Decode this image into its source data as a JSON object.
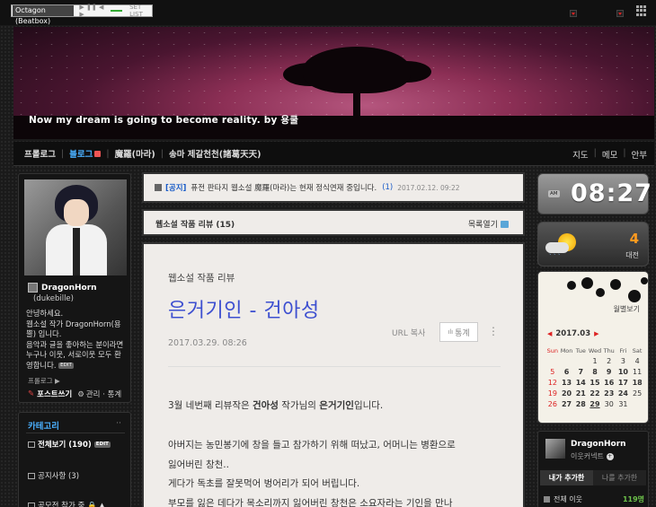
{
  "topbar": {
    "beatbox_title": "Octagon (Beatbox)",
    "player_controls": "▶ ❚❚ ◀ ▶",
    "list_label": "SET LIST"
  },
  "banner": {
    "slogan": "Now my dream is going to become reality. by 용쿨"
  },
  "nav": {
    "items": [
      {
        "label": "프롤로그"
      },
      {
        "label": "블로그"
      },
      {
        "label": "魔羅(마라)"
      },
      {
        "label": "송마 제갈천천(諸葛天天)"
      }
    ],
    "right": [
      "지도",
      "메모",
      "안부"
    ]
  },
  "profile": {
    "name": "DragonHorn",
    "id": "(dukebille)",
    "intro": "안녕하세요.\n웹소설 작가 DragonHorn(용뿔) 입니다.\n음악과 글을 좋아하는 분이라면 누구나 이웃, 서로이웃 모두 환영합니다.",
    "edit_badge": "EDIT",
    "profile_link": "프롤로그 ▶",
    "write_label": "포스트쓰기",
    "admin_label": "관리 · 통계"
  },
  "category": {
    "title": "카테고리",
    "more": "··",
    "items": [
      {
        "label": "전체보기 (190)",
        "badge": "EDIT"
      },
      {
        "label": "공지사항 (3)"
      },
      {
        "label": "공모전 참가 중 🔒 ▲"
      }
    ]
  },
  "notice": {
    "tag": "[공지]",
    "text": "퓨전 판타지 웹소설 魔羅(마라)는 현재 정식연재 중입니다.",
    "count": "(1)",
    "date": "2017.02.12. 09:22"
  },
  "category_header": {
    "title": "웹소설 작품 리뷰 (15)",
    "list_toggle": "목록열기"
  },
  "article": {
    "category": "웹소설 작품 리뷰",
    "title": "은거기인 - 건아성",
    "url_copy": "URL 복사",
    "stat_btn": "통계",
    "more_icon": "⋮",
    "date": "2017.03.29. 08:26",
    "para1_pre": "3월 네번째 리뷰작은 ",
    "para1_author": "건아성",
    "para1_mid": " 작가님의 ",
    "para1_work": "은거기인",
    "para1_post": "입니다.",
    "para2_l1": "아버지는 농민봉기에 창을 들고 참가하기 위해 떠났고, 어머니는 병환으로",
    "para2_l2": "잃어버린 창천..",
    "para2_l3": "게다가 독초를 잘못먹어 벙어리가 되어 버립니다.",
    "para2_l4": "부모를 잃은 데다가 목소리까지 잃어버린 창천은 소요자라는 기인을 만나"
  },
  "clock": {
    "ampm": "AM",
    "time": "08:27"
  },
  "weather": {
    "temp": "4",
    "city": "대전",
    "rain": "` ` `"
  },
  "calendar": {
    "wallpaper_btn": "월별보기",
    "month": "2017.03",
    "prev": "◀",
    "next": "▶",
    "weekdays": [
      "Sun",
      "Mon",
      "Tue",
      "Wed",
      "Thu",
      "Fri",
      "Sat"
    ],
    "days": [
      "",
      "",
      "",
      "1",
      "2",
      "3",
      "4",
      "5",
      "6",
      "7",
      "8",
      "9",
      "10",
      "11",
      "12",
      "13",
      "14",
      "15",
      "16",
      "17",
      "18",
      "19",
      "20",
      "21",
      "22",
      "23",
      "24",
      "25",
      "26",
      "27",
      "28",
      "29",
      "30",
      "31",
      ""
    ],
    "bold_days": [
      "6",
      "7",
      "8",
      "9",
      "10",
      "13",
      "14",
      "15",
      "16",
      "17",
      "18",
      "20",
      "21",
      "22",
      "23",
      "24",
      "27",
      "28",
      "29"
    ],
    "today": "29"
  },
  "neighbor": {
    "name": "DragonHorn",
    "link": "이웃커넥트",
    "plus": "+",
    "tab_active": "내가 추가한",
    "tab_inactive": "나를 추가한",
    "row_label": "전체 이웃",
    "row_count": "119명"
  },
  "colors": {
    "accent_blue": "#4ab0ff",
    "title_blue": "#3d4fd0",
    "sunday_red": "#d22222",
    "temp_orange": "#ff9a1f"
  }
}
